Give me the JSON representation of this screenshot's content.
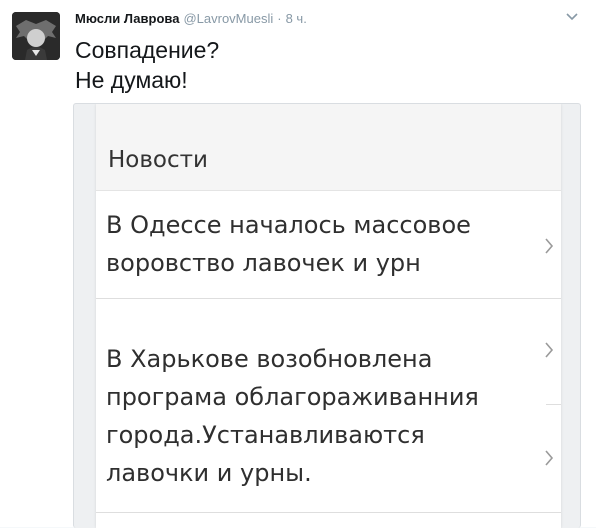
{
  "tweet": {
    "display_name": "Мюсли Лаврова",
    "handle": "@LavrovMuesli",
    "separator": "·",
    "time": "8 ч.",
    "text_lines": [
      "Совпадение?",
      "Не думаю!"
    ]
  },
  "news_card": {
    "section_title": "Новости",
    "items": [
      {
        "lines": [
          "В Одессе началось массовое",
          "воровство лавочек и урн"
        ]
      },
      {
        "lines": [
          "В Харькове возобновлена",
          "програма облагораживанния",
          "города.Устанавливаются",
          "лавочки и урны."
        ]
      }
    ]
  },
  "colors": {
    "text": "#14171a",
    "muted": "#8899a6",
    "card_text": "#2f2f2f"
  }
}
